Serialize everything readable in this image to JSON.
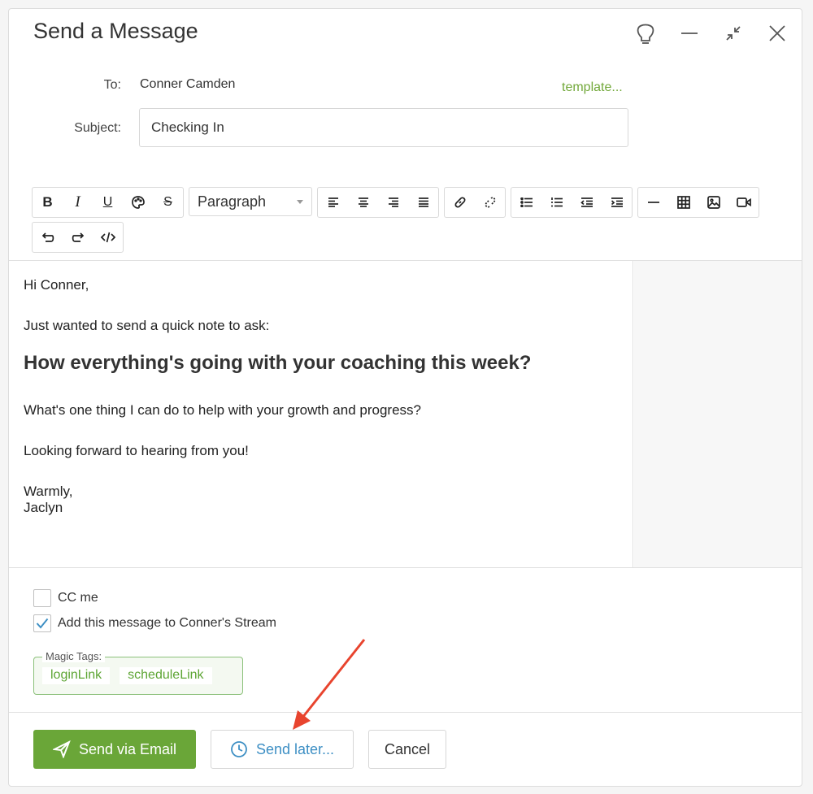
{
  "dialog": {
    "title": "Send a Message"
  },
  "header_icons": [
    "lightbulb-icon",
    "minimize-icon",
    "collapse-icon",
    "close-icon"
  ],
  "form": {
    "to_label": "To:",
    "to_value": "Conner Camden",
    "template_link": "template...",
    "subject_label": "Subject:",
    "subject_value": "Checking In"
  },
  "toolbar": {
    "paragraph_select": "Paragraph",
    "icons": [
      "bold",
      "italic",
      "underline",
      "text-color",
      "strikethrough",
      "align-left",
      "align-center",
      "align-right",
      "justify",
      "link",
      "unlink",
      "bullet-list",
      "numbered-list",
      "outdent",
      "indent",
      "horizontal-rule",
      "table",
      "image",
      "video",
      "undo",
      "redo",
      "source-code"
    ]
  },
  "editor": {
    "greeting": "Hi Conner,",
    "line1": "Just wanted to send a quick note to ask:",
    "heading": "How everything's going with your coaching this week?",
    "line2": "What's one thing I can do to help with your growth and progress?",
    "line3": "Looking forward to hearing from you!",
    "signoff": "Warmly,",
    "signature": "Jaclyn"
  },
  "options": {
    "cc_me": {
      "label": "CC me",
      "checked": false
    },
    "add_stream": {
      "label": "Add this message to Conner's Stream",
      "checked": true
    }
  },
  "magic_tags": {
    "legend": "Magic Tags:",
    "tags": [
      "loginLink",
      "scheduleLink"
    ]
  },
  "buttons": {
    "send_email": "Send via Email",
    "send_later": "Send later...",
    "cancel": "Cancel"
  },
  "colors": {
    "accent_green": "#6aa638",
    "link_blue": "#3d8fc4",
    "annotation_arrow": "#e8442e"
  }
}
